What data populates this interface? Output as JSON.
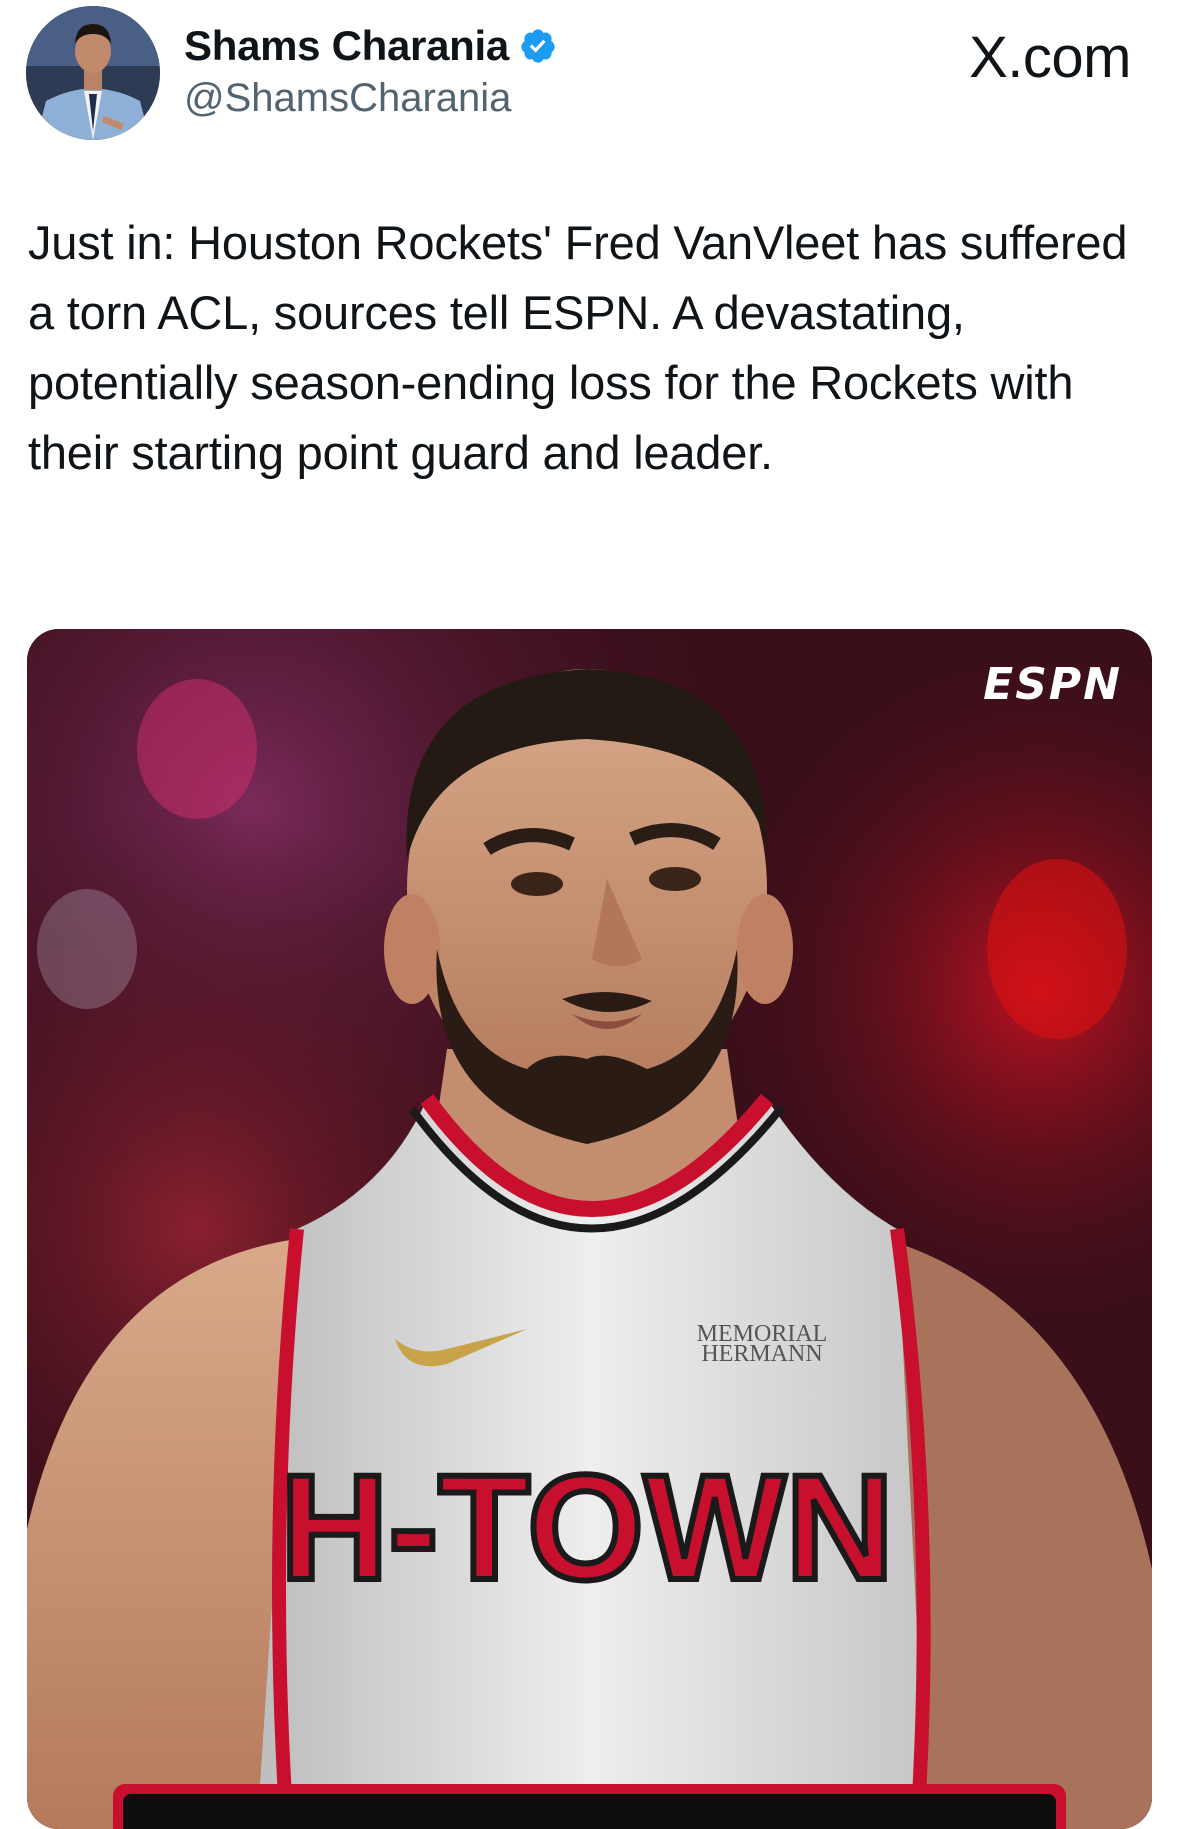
{
  "author": {
    "name": "Shams Charania",
    "handle": "@ShamsCharania",
    "verified": true,
    "avatar_icon": "profile-photo"
  },
  "site_label": "X.com",
  "tweet": {
    "text": "Just in: Houston Rockets' Fred VanVleet has suffered a torn ACL, sources tell ESPN. A devastating, potentially season-ending loss for the Rockets with their starting point guard and leader."
  },
  "media": {
    "logo": "ESPN",
    "jersey_sponsor": "MEMORIAL HERMANN",
    "jersey_wordmark": "H-TOWN"
  },
  "colors": {
    "verified_blue": "#1d9bf0",
    "text_primary": "#0f1419",
    "text_secondary": "#536471",
    "rockets_red": "#ce1141"
  }
}
